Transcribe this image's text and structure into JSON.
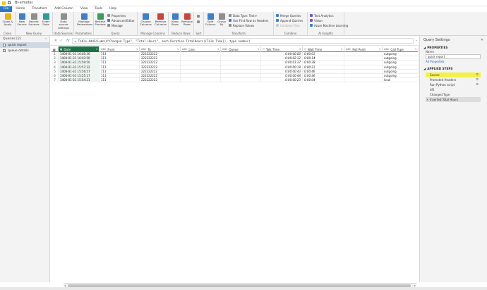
{
  "window": {
    "title": "BI-simotel"
  },
  "menu": [
    "File",
    "Home",
    "Transform",
    "Add Column",
    "View",
    "Tools",
    "Help"
  ],
  "ribbon": {
    "close": {
      "btn": "Close & Apply",
      "group": "Close"
    },
    "newquery": {
      "new_source": "New Source",
      "recent_sources": "Recent Sources",
      "enter_data": "Enter Data",
      "group": "New Query"
    },
    "datasources": {
      "btn": "Data source settings",
      "group": "Data Sources"
    },
    "parameters": {
      "btn": "Manage Parameters",
      "group": "Parameters"
    },
    "query": {
      "refresh": "Refresh Preview",
      "properties": "Properties",
      "advanced_editor": "Advanced Editor",
      "manage": "Manage",
      "group": "Query"
    },
    "managecols": {
      "choose": "Choose Columns",
      "remove": "Remove Columns",
      "group": "Manage Columns"
    },
    "reducerows": {
      "keep": "Keep Rows",
      "remove": "Remove Rows",
      "group": "Reduce Rows"
    },
    "sort": {
      "group": "Sort"
    },
    "transform": {
      "split": "Split Column",
      "groupby": "Group By",
      "datatype": "Data Type: Text",
      "firstrow": "Use First Row as Headers",
      "replace": "Replace Values",
      "group": "Transform"
    },
    "combine": {
      "merge": "Merge Queries",
      "append": "Append Queries",
      "combine_files": "Combine Files",
      "group": "Combine"
    },
    "ai": {
      "text": "Text Analytics",
      "vision": "Vision",
      "azure": "Azure Machine Learning",
      "group": "AI Insights"
    }
  },
  "queries": {
    "header": "Queries [2]",
    "items": [
      "quick report",
      "queue details"
    ]
  },
  "formula": {
    "text": "= Table.AddColumn(#\"Changed Type\", \"Total Hours\", each Duration.TotalHours([Talk Time]), type number)"
  },
  "columns": [
    {
      "type": "▦",
      "name": "Date"
    },
    {
      "type": "ABC",
      "name": "From"
    },
    {
      "type": "ABC",
      "name": "To"
    },
    {
      "type": "ABC",
      "name": "Line"
    },
    {
      "type": "ABC",
      "name": "Queue"
    },
    {
      "type": "⏱",
      "name": "Talk Time"
    },
    {
      "type": "⏱",
      "name": "Wait Time"
    },
    {
      "type": "ABC",
      "name": "Poll Point"
    },
    {
      "type": "ABC",
      "name": "Call Type"
    }
  ],
  "rows": [
    {
      "n": "1",
      "date": "1404-01-31 16:05:36",
      "from": "111",
      "to": "222222222",
      "line": "",
      "queue": "",
      "talk": "0:00:00:00",
      "wait": "0:00:01",
      "poll": "",
      "type": "outgoing"
    },
    {
      "n": "2",
      "date": "1404-01-31 16:03:56",
      "from": "111",
      "to": "222222222",
      "line": "",
      "queue": "",
      "talk": "0:00:02:12",
      "wait": "0:00:14",
      "poll": "",
      "type": "outgoing"
    },
    {
      "n": "3",
      "date": "1404-01-31 15:59:50",
      "from": "111",
      "to": "222222222",
      "line": "",
      "queue": "",
      "talk": "0:00:01:37",
      "wait": "0:00:38",
      "poll": "",
      "type": "outgoing"
    },
    {
      "n": "4",
      "date": "1404-01-31 15:57:32",
      "from": "111",
      "to": "222222222",
      "line": "",
      "queue": "",
      "talk": "0:00:00:19",
      "wait": "0:00:21",
      "poll": "",
      "type": "outgoing"
    },
    {
      "n": "5",
      "date": "1404-01-31 15:56:57",
      "from": "111",
      "to": "222222222",
      "line": "",
      "queue": "",
      "talk": "0:00:00:43",
      "wait": "0:00:46",
      "poll": "",
      "type": "outgoing"
    },
    {
      "n": "6",
      "date": "1404-01-31 15:55:17",
      "from": "111",
      "to": "222222222",
      "line": "",
      "queue": "",
      "talk": "0:00:00:44",
      "wait": "0:00:46",
      "poll": "",
      "type": "outgoing"
    },
    {
      "n": "7",
      "date": "1404-01-31 15:54:21",
      "from": "111",
      "to": "222222222",
      "line": "",
      "queue": "",
      "talk": "0:00:00:23",
      "wait": "0:00:04",
      "poll": "",
      "type": "local"
    }
  ],
  "settings": {
    "title": "Query Settings",
    "properties": "PROPERTIES",
    "name_label": "Name",
    "name_value": "quick report",
    "all_properties": "All Properties",
    "applied_steps": "APPLIED STEPS",
    "steps": [
      "Source",
      "Promoted Headers",
      "Run Python script",
      "df1",
      "Changed Type",
      "Inserted Total Hours"
    ]
  }
}
